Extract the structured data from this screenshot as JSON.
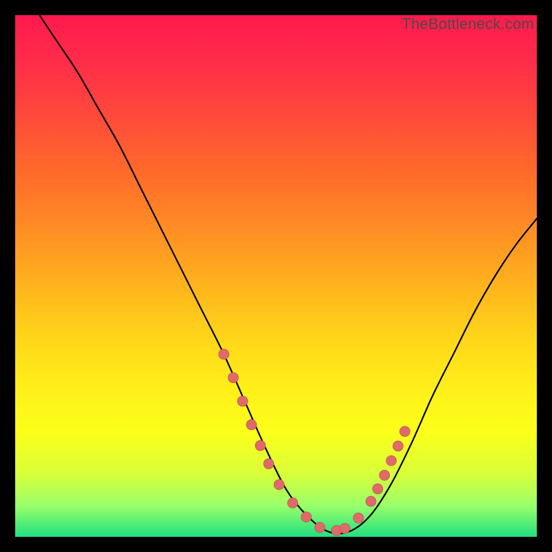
{
  "watermark": "TheBottleneck.com",
  "colors": {
    "curve": "#000000",
    "dot_fill": "#e06a6a",
    "dot_stroke": "#b24a4a",
    "gradient_top": "#ff1a4d",
    "gradient_bottom": "#20e080"
  },
  "chart_data": {
    "type": "line",
    "title": "",
    "xlabel": "",
    "ylabel": "",
    "xlim": [
      0,
      100
    ],
    "ylim": [
      0,
      100
    ],
    "series": [
      {
        "name": "bottleneck-curve",
        "x": [
          0,
          4,
          8,
          12,
          16,
          20,
          24,
          28,
          32,
          36,
          40,
          44,
          48,
          52,
          56,
          60,
          64,
          68,
          72,
          76,
          80,
          84,
          88,
          92,
          96,
          100
        ],
        "y": [
          107,
          101,
          95,
          89,
          82,
          75,
          67,
          59,
          51,
          43,
          35,
          26,
          17,
          9,
          4,
          1,
          1,
          4,
          10,
          18,
          27,
          35,
          43,
          50,
          56,
          61
        ]
      }
    ],
    "dots": {
      "name": "highlight-dots",
      "x": [
        40.0,
        41.8,
        43.6,
        45.3,
        47.0,
        48.6,
        50.6,
        53.2,
        55.8,
        58.4,
        61.6,
        63.2,
        65.8,
        68.2,
        69.5,
        70.8,
        72.1,
        73.4,
        74.7
      ],
      "y": [
        35.0,
        30.5,
        26.0,
        21.5,
        17.5,
        14.0,
        10.0,
        6.5,
        3.8,
        1.8,
        1.2,
        1.6,
        3.6,
        6.8,
        9.2,
        11.8,
        14.6,
        17.4,
        20.2
      ],
      "radius": 7.5
    }
  }
}
